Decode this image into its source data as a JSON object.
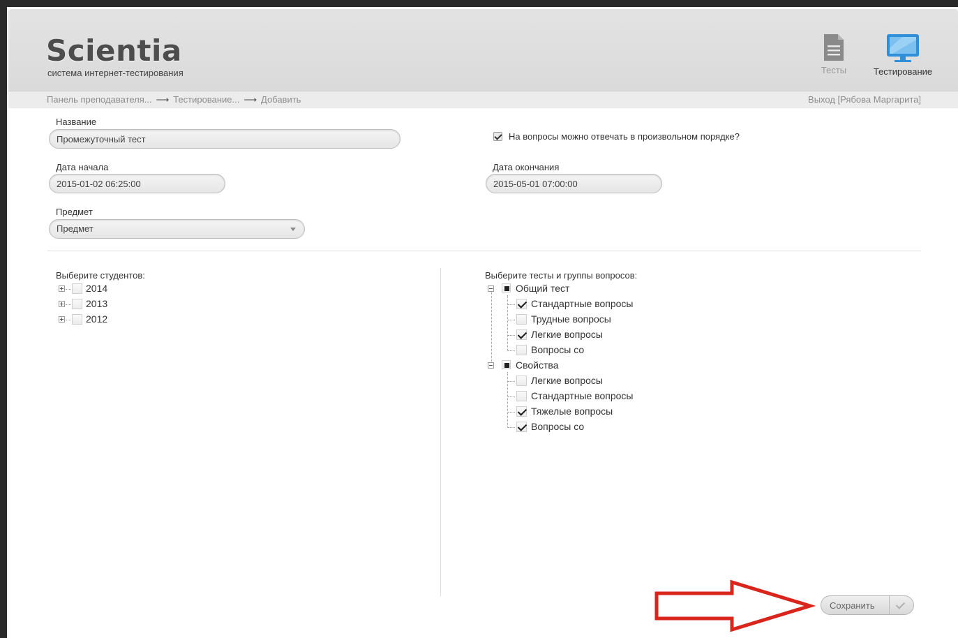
{
  "app": {
    "logo": "Scientia",
    "tagline": "система интернет-тестирования"
  },
  "nav": {
    "tests_label": "Тесты",
    "testing_label": "Тестирование",
    "tests_icon": "document-icon",
    "testing_icon": "monitor-icon"
  },
  "breadcrumb": {
    "items": [
      "Панель преподавателя...",
      "Тестирование...",
      "Добавить"
    ],
    "separator": "⟶",
    "logout": "Выход [Рябова Маргарита]"
  },
  "form": {
    "name_label": "Название",
    "name_value": "Промежуточный тест",
    "random_order_label": "На вопросы можно отвечать в произвольном порядке?",
    "random_order_checked": true,
    "start_label": "Дата начала",
    "start_value": "2015-01-02 06:25:00",
    "end_label": "Дата окончания",
    "end_value": "2015-05-01 07:00:00",
    "subject_label": "Предмет",
    "subject_value": "Предмет"
  },
  "students": {
    "title": "Выберите студентов:",
    "groups": [
      "2014",
      "2013",
      "2012"
    ]
  },
  "tests": {
    "title": "Выберите тесты и группы вопросов:",
    "groups": [
      {
        "name": "Общий тест",
        "items": [
          {
            "label": "Стандартные вопросы",
            "checked": true
          },
          {
            "label": "Трудные вопросы",
            "checked": false
          },
          {
            "label": "Легкие вопросы",
            "checked": true
          },
          {
            "label": "Вопросы со",
            "checked": false
          }
        ]
      },
      {
        "name": "Свойства",
        "items": [
          {
            "label": "Легкие вопросы",
            "checked": false
          },
          {
            "label": "Стандартные вопросы",
            "checked": false
          },
          {
            "label": "Тяжелые вопросы",
            "checked": true
          },
          {
            "label": "Вопросы со",
            "checked": true
          }
        ]
      }
    ]
  },
  "actions": {
    "save_label": "Сохранить"
  },
  "colors": {
    "header_bg": "#dddddd",
    "accent_blue": "#2f8fd8",
    "annotation_red": "#d9261c"
  }
}
